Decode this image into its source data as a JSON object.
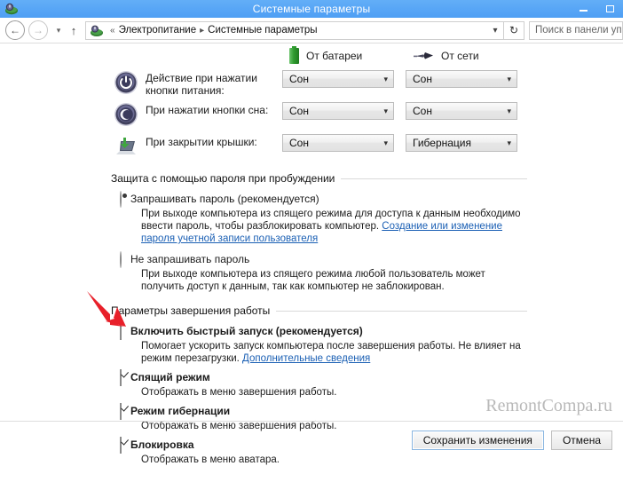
{
  "window": {
    "title": "Системные параметры",
    "icon": "power-options-icon",
    "minimize_label": "Свернуть",
    "maximize_label": "Развернуть"
  },
  "nav": {
    "back_icon": "back-arrow-icon",
    "forward_icon": "forward-arrow-icon",
    "history_icon": "chevron-down-icon",
    "up_icon": "up-arrow-icon",
    "address_icon": "power-options-icon",
    "breadcrumb_prefix": "«",
    "breadcrumbs": [
      "Электропитание",
      "Системные параметры"
    ],
    "breadcrumb_sep": "▸",
    "dropdown_icon": "chevron-down-icon",
    "refresh_icon": "refresh-icon",
    "search_placeholder": "Поиск в панели управления"
  },
  "columns": [
    {
      "icon": "battery-icon",
      "label": "От батареи"
    },
    {
      "icon": "power-plug-icon",
      "label": "От сети"
    }
  ],
  "settings_rows": [
    {
      "icon": "power-button-icon",
      "label": "Действие при нажатии кнопки питания:",
      "battery_value": "Сон",
      "ac_value": "Сон"
    },
    {
      "icon": "sleep-moon-icon",
      "label": "При нажатии кнопки сна:",
      "battery_value": "Сон",
      "ac_value": "Сон"
    },
    {
      "icon": "laptop-lid-icon",
      "label": "При закрытии крышки:",
      "battery_value": "Сон",
      "ac_value": "Гибернация"
    }
  ],
  "password_group": {
    "title": "Защита с помощью пароля при пробуждении",
    "options": [
      {
        "type": "radio",
        "checked": true,
        "title": "Запрашивать пароль (рекомендуется)",
        "desc_before": "При выходе компьютера из спящего режима для доступа к данным необходимо ввести пароль, чтобы разблокировать компьютер. ",
        "link": "Создание или изменение пароля учетной записи пользователя",
        "desc_after": ""
      },
      {
        "type": "radio",
        "checked": false,
        "title": "Не запрашивать пароль",
        "desc_before": "При выходе компьютера из спящего режима любой пользователь может получить доступ к данным, так как компьютер не заблокирован.",
        "link": "",
        "desc_after": ""
      }
    ]
  },
  "shutdown_group": {
    "title": "Параметры завершения работы",
    "options": [
      {
        "type": "checkbox",
        "checked": false,
        "bold": true,
        "title": "Включить быстрый запуск (рекомендуется)",
        "desc_before": "Помогает ускорить запуск компьютера после завершения работы. Не влияет на режим перезагрузки. ",
        "link": "Дополнительные сведения",
        "desc_after": ""
      },
      {
        "type": "checkbox",
        "checked": true,
        "bold": true,
        "title": "Спящий режим",
        "desc_before": "Отображать в меню завершения работы.",
        "link": "",
        "desc_after": ""
      },
      {
        "type": "checkbox",
        "checked": true,
        "bold": true,
        "title": "Режим гибернации",
        "desc_before": "Отображать в меню завершения работы.",
        "link": "",
        "desc_after": ""
      },
      {
        "type": "checkbox",
        "checked": true,
        "bold": true,
        "title": "Блокировка",
        "desc_before": "Отображать в меню аватара.",
        "link": "",
        "desc_after": ""
      }
    ]
  },
  "footer": {
    "save_label": "Сохранить изменения",
    "cancel_label": "Отмена"
  },
  "watermark": "RemontCompa.ru",
  "annotation": {
    "type": "red-arrow",
    "color": "#e8202a",
    "points_to": "fast-startup-checkbox"
  },
  "colors": {
    "titlebar": "#58a6f6",
    "link": "#1a5fb4",
    "battery_green": "#2f9b2f",
    "annotation_red": "#e8202a"
  }
}
